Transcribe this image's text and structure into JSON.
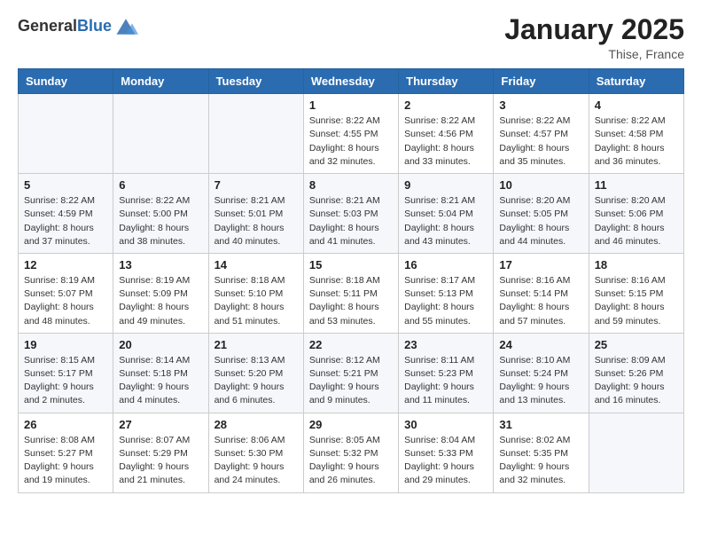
{
  "logo": {
    "general": "General",
    "blue": "Blue"
  },
  "header": {
    "month": "January 2025",
    "location": "Thise, France"
  },
  "weekdays": [
    "Sunday",
    "Monday",
    "Tuesday",
    "Wednesday",
    "Thursday",
    "Friday",
    "Saturday"
  ],
  "weeks": [
    [
      {
        "day": "",
        "sunrise": "",
        "sunset": "",
        "daylight": ""
      },
      {
        "day": "",
        "sunrise": "",
        "sunset": "",
        "daylight": ""
      },
      {
        "day": "",
        "sunrise": "",
        "sunset": "",
        "daylight": ""
      },
      {
        "day": "1",
        "sunrise": "Sunrise: 8:22 AM",
        "sunset": "Sunset: 4:55 PM",
        "daylight": "Daylight: 8 hours and 32 minutes."
      },
      {
        "day": "2",
        "sunrise": "Sunrise: 8:22 AM",
        "sunset": "Sunset: 4:56 PM",
        "daylight": "Daylight: 8 hours and 33 minutes."
      },
      {
        "day": "3",
        "sunrise": "Sunrise: 8:22 AM",
        "sunset": "Sunset: 4:57 PM",
        "daylight": "Daylight: 8 hours and 35 minutes."
      },
      {
        "day": "4",
        "sunrise": "Sunrise: 8:22 AM",
        "sunset": "Sunset: 4:58 PM",
        "daylight": "Daylight: 8 hours and 36 minutes."
      }
    ],
    [
      {
        "day": "5",
        "sunrise": "Sunrise: 8:22 AM",
        "sunset": "Sunset: 4:59 PM",
        "daylight": "Daylight: 8 hours and 37 minutes."
      },
      {
        "day": "6",
        "sunrise": "Sunrise: 8:22 AM",
        "sunset": "Sunset: 5:00 PM",
        "daylight": "Daylight: 8 hours and 38 minutes."
      },
      {
        "day": "7",
        "sunrise": "Sunrise: 8:21 AM",
        "sunset": "Sunset: 5:01 PM",
        "daylight": "Daylight: 8 hours and 40 minutes."
      },
      {
        "day": "8",
        "sunrise": "Sunrise: 8:21 AM",
        "sunset": "Sunset: 5:03 PM",
        "daylight": "Daylight: 8 hours and 41 minutes."
      },
      {
        "day": "9",
        "sunrise": "Sunrise: 8:21 AM",
        "sunset": "Sunset: 5:04 PM",
        "daylight": "Daylight: 8 hours and 43 minutes."
      },
      {
        "day": "10",
        "sunrise": "Sunrise: 8:20 AM",
        "sunset": "Sunset: 5:05 PM",
        "daylight": "Daylight: 8 hours and 44 minutes."
      },
      {
        "day": "11",
        "sunrise": "Sunrise: 8:20 AM",
        "sunset": "Sunset: 5:06 PM",
        "daylight": "Daylight: 8 hours and 46 minutes."
      }
    ],
    [
      {
        "day": "12",
        "sunrise": "Sunrise: 8:19 AM",
        "sunset": "Sunset: 5:07 PM",
        "daylight": "Daylight: 8 hours and 48 minutes."
      },
      {
        "day": "13",
        "sunrise": "Sunrise: 8:19 AM",
        "sunset": "Sunset: 5:09 PM",
        "daylight": "Daylight: 8 hours and 49 minutes."
      },
      {
        "day": "14",
        "sunrise": "Sunrise: 8:18 AM",
        "sunset": "Sunset: 5:10 PM",
        "daylight": "Daylight: 8 hours and 51 minutes."
      },
      {
        "day": "15",
        "sunrise": "Sunrise: 8:18 AM",
        "sunset": "Sunset: 5:11 PM",
        "daylight": "Daylight: 8 hours and 53 minutes."
      },
      {
        "day": "16",
        "sunrise": "Sunrise: 8:17 AM",
        "sunset": "Sunset: 5:13 PM",
        "daylight": "Daylight: 8 hours and 55 minutes."
      },
      {
        "day": "17",
        "sunrise": "Sunrise: 8:16 AM",
        "sunset": "Sunset: 5:14 PM",
        "daylight": "Daylight: 8 hours and 57 minutes."
      },
      {
        "day": "18",
        "sunrise": "Sunrise: 8:16 AM",
        "sunset": "Sunset: 5:15 PM",
        "daylight": "Daylight: 8 hours and 59 minutes."
      }
    ],
    [
      {
        "day": "19",
        "sunrise": "Sunrise: 8:15 AM",
        "sunset": "Sunset: 5:17 PM",
        "daylight": "Daylight: 9 hours and 2 minutes."
      },
      {
        "day": "20",
        "sunrise": "Sunrise: 8:14 AM",
        "sunset": "Sunset: 5:18 PM",
        "daylight": "Daylight: 9 hours and 4 minutes."
      },
      {
        "day": "21",
        "sunrise": "Sunrise: 8:13 AM",
        "sunset": "Sunset: 5:20 PM",
        "daylight": "Daylight: 9 hours and 6 minutes."
      },
      {
        "day": "22",
        "sunrise": "Sunrise: 8:12 AM",
        "sunset": "Sunset: 5:21 PM",
        "daylight": "Daylight: 9 hours and 9 minutes."
      },
      {
        "day": "23",
        "sunrise": "Sunrise: 8:11 AM",
        "sunset": "Sunset: 5:23 PM",
        "daylight": "Daylight: 9 hours and 11 minutes."
      },
      {
        "day": "24",
        "sunrise": "Sunrise: 8:10 AM",
        "sunset": "Sunset: 5:24 PM",
        "daylight": "Daylight: 9 hours and 13 minutes."
      },
      {
        "day": "25",
        "sunrise": "Sunrise: 8:09 AM",
        "sunset": "Sunset: 5:26 PM",
        "daylight": "Daylight: 9 hours and 16 minutes."
      }
    ],
    [
      {
        "day": "26",
        "sunrise": "Sunrise: 8:08 AM",
        "sunset": "Sunset: 5:27 PM",
        "daylight": "Daylight: 9 hours and 19 minutes."
      },
      {
        "day": "27",
        "sunrise": "Sunrise: 8:07 AM",
        "sunset": "Sunset: 5:29 PM",
        "daylight": "Daylight: 9 hours and 21 minutes."
      },
      {
        "day": "28",
        "sunrise": "Sunrise: 8:06 AM",
        "sunset": "Sunset: 5:30 PM",
        "daylight": "Daylight: 9 hours and 24 minutes."
      },
      {
        "day": "29",
        "sunrise": "Sunrise: 8:05 AM",
        "sunset": "Sunset: 5:32 PM",
        "daylight": "Daylight: 9 hours and 26 minutes."
      },
      {
        "day": "30",
        "sunrise": "Sunrise: 8:04 AM",
        "sunset": "Sunset: 5:33 PM",
        "daylight": "Daylight: 9 hours and 29 minutes."
      },
      {
        "day": "31",
        "sunrise": "Sunrise: 8:02 AM",
        "sunset": "Sunset: 5:35 PM",
        "daylight": "Daylight: 9 hours and 32 minutes."
      },
      {
        "day": "",
        "sunrise": "",
        "sunset": "",
        "daylight": ""
      }
    ]
  ]
}
